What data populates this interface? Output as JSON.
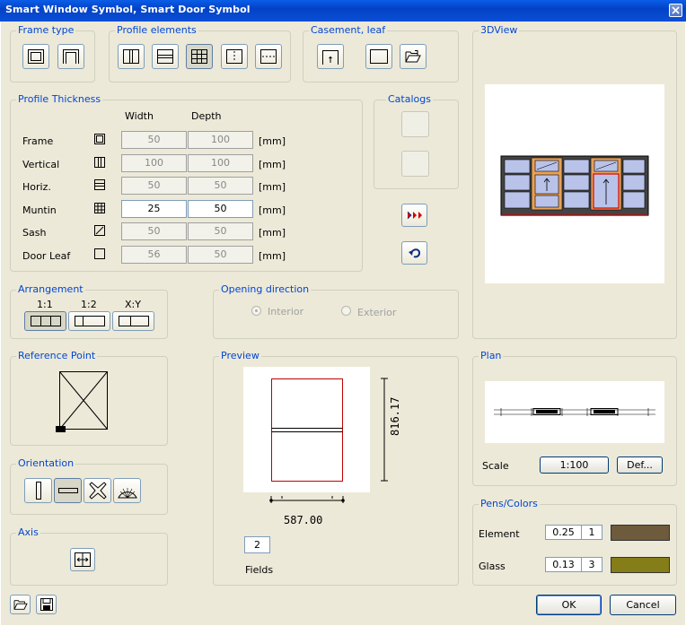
{
  "window": {
    "title": "Smart Window Symbol, Smart Door Symbol"
  },
  "groups": {
    "frame_type": "Frame type",
    "profile_elements": "Profile elements",
    "casement": "Casement, leaf",
    "view3d": "3DView",
    "profile_thickness": "Profile Thickness",
    "catalogs": "Catalogs",
    "arrangement": "Arrangement",
    "opening_direction": "Opening direction",
    "reference_point": "Reference Point",
    "preview": "Preview",
    "plan": "Plan",
    "orientation": "Orientation",
    "axis": "Axis",
    "pens_colors": "Pens/Colors"
  },
  "thickness": {
    "col_width": "Width",
    "col_depth": "Depth",
    "rows": [
      {
        "label": "Frame",
        "width": "50",
        "depth": "100",
        "unit": "[mm]",
        "active": false
      },
      {
        "label": "Vertical",
        "width": "100",
        "depth": "100",
        "unit": "[mm]",
        "active": false
      },
      {
        "label": "Horiz.",
        "width": "50",
        "depth": "50",
        "unit": "[mm]",
        "active": false
      },
      {
        "label": "Muntin",
        "width": "25",
        "depth": "50",
        "unit": "[mm]",
        "active": true
      },
      {
        "label": "Sash",
        "width": "50",
        "depth": "50",
        "unit": "[mm]",
        "active": false
      },
      {
        "label": "Door Leaf",
        "width": "56",
        "depth": "50",
        "unit": "[mm]",
        "active": false
      }
    ]
  },
  "arrangement": {
    "r1": "1:1",
    "r2": "1:2",
    "r3": "X:Y"
  },
  "opening": {
    "interior": "Interior",
    "exterior": "Exterior"
  },
  "preview": {
    "height_dim": "816.17",
    "width_dim": "587.00",
    "fields_value": "2",
    "fields_label": "Fields"
  },
  "plan": {
    "scale_label": "Scale",
    "scale_value": "1:100",
    "def_button": "Def..."
  },
  "pens": {
    "element_label": "Element",
    "element_pen": "0.25",
    "element_num": "1",
    "element_color": "#6e5a3c",
    "glass_label": "Glass",
    "glass_pen": "0.13",
    "glass_num": "3",
    "glass_color": "#857d18"
  },
  "buttons": {
    "ok": "OK",
    "cancel": "Cancel"
  },
  "icons": {
    "frame_rect": "frame-rect-icon",
    "frame_door": "frame-door-icon",
    "vertical": "vertical-split-icon",
    "horizontal": "horizontal-split-icon",
    "muntin": "muntin-grid-icon",
    "dotted_v": "dotted-vertical-icon",
    "dotted_h": "dotted-horizontal-icon",
    "casement": "casement-icon",
    "leaf": "leaf-icon",
    "open": "open-folder-icon",
    "next": "triple-arrow-icon",
    "undo": "undo-icon",
    "save": "save-icon",
    "load": "open-folder-icon"
  }
}
